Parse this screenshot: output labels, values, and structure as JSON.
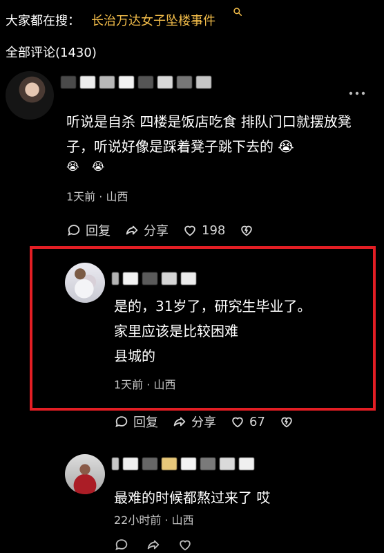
{
  "top_search": {
    "prefix": "大家都在搜：",
    "query": "长治万达女子坠楼事件",
    "icon": "search-icon"
  },
  "comments_header": {
    "title": "全部评论(1430)"
  },
  "comments": [
    {
      "text": "听说是自杀 四楼是饭店吃食 排队门口就摆放凳子，听说好像是踩着凳子跳下去的 😭",
      "emojis": [
        "😭",
        "😭"
      ],
      "meta": "1天前 · 山西",
      "actions": {
        "reply": "回复",
        "share": "分享",
        "likes": "198"
      }
    },
    {
      "text_lines": [
        "是的，31岁了，研究生毕业了。",
        "家里应该是比较困难",
        "县城的"
      ],
      "meta": "1天前 · 山西",
      "actions": {
        "reply": "回复",
        "share": "分享",
        "likes": "67"
      }
    },
    {
      "text": "最难的时候都熬过来了 哎",
      "meta": "22小时前 · 山西"
    }
  ],
  "colors": {
    "link": "#f3bd4a",
    "highlight_border": "#e31e24"
  }
}
